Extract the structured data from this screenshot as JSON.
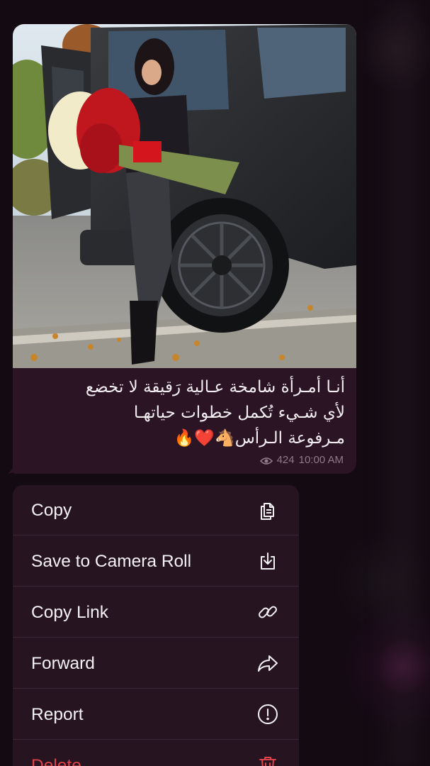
{
  "message": {
    "caption_lines": [
      "أنـا أمـرأة شامخة عـالية رَقيقة لا تخضع",
      "لأي شـيء تُكمل خطوات حياتهـا",
      "مـرفوعة الـرأس🐴❤️🔥"
    ],
    "views": "424",
    "time": "10:00 AM",
    "photo_alt": "photo"
  },
  "context_menu": {
    "items": [
      {
        "label": "Copy",
        "icon": "copy-icon"
      },
      {
        "label": "Save to Camera Roll",
        "icon": "save-download-icon"
      },
      {
        "label": "Copy Link",
        "icon": "link-icon"
      },
      {
        "label": "Forward",
        "icon": "forward-arrow-icon"
      },
      {
        "label": "Report",
        "icon": "report-exclamation-icon"
      },
      {
        "label": "Delete",
        "icon": "trash-icon"
      }
    ]
  },
  "colors": {
    "bubble": "#2b1423",
    "menu": "#261421",
    "danger": "#e0424a",
    "meta": "#8f7a88"
  }
}
